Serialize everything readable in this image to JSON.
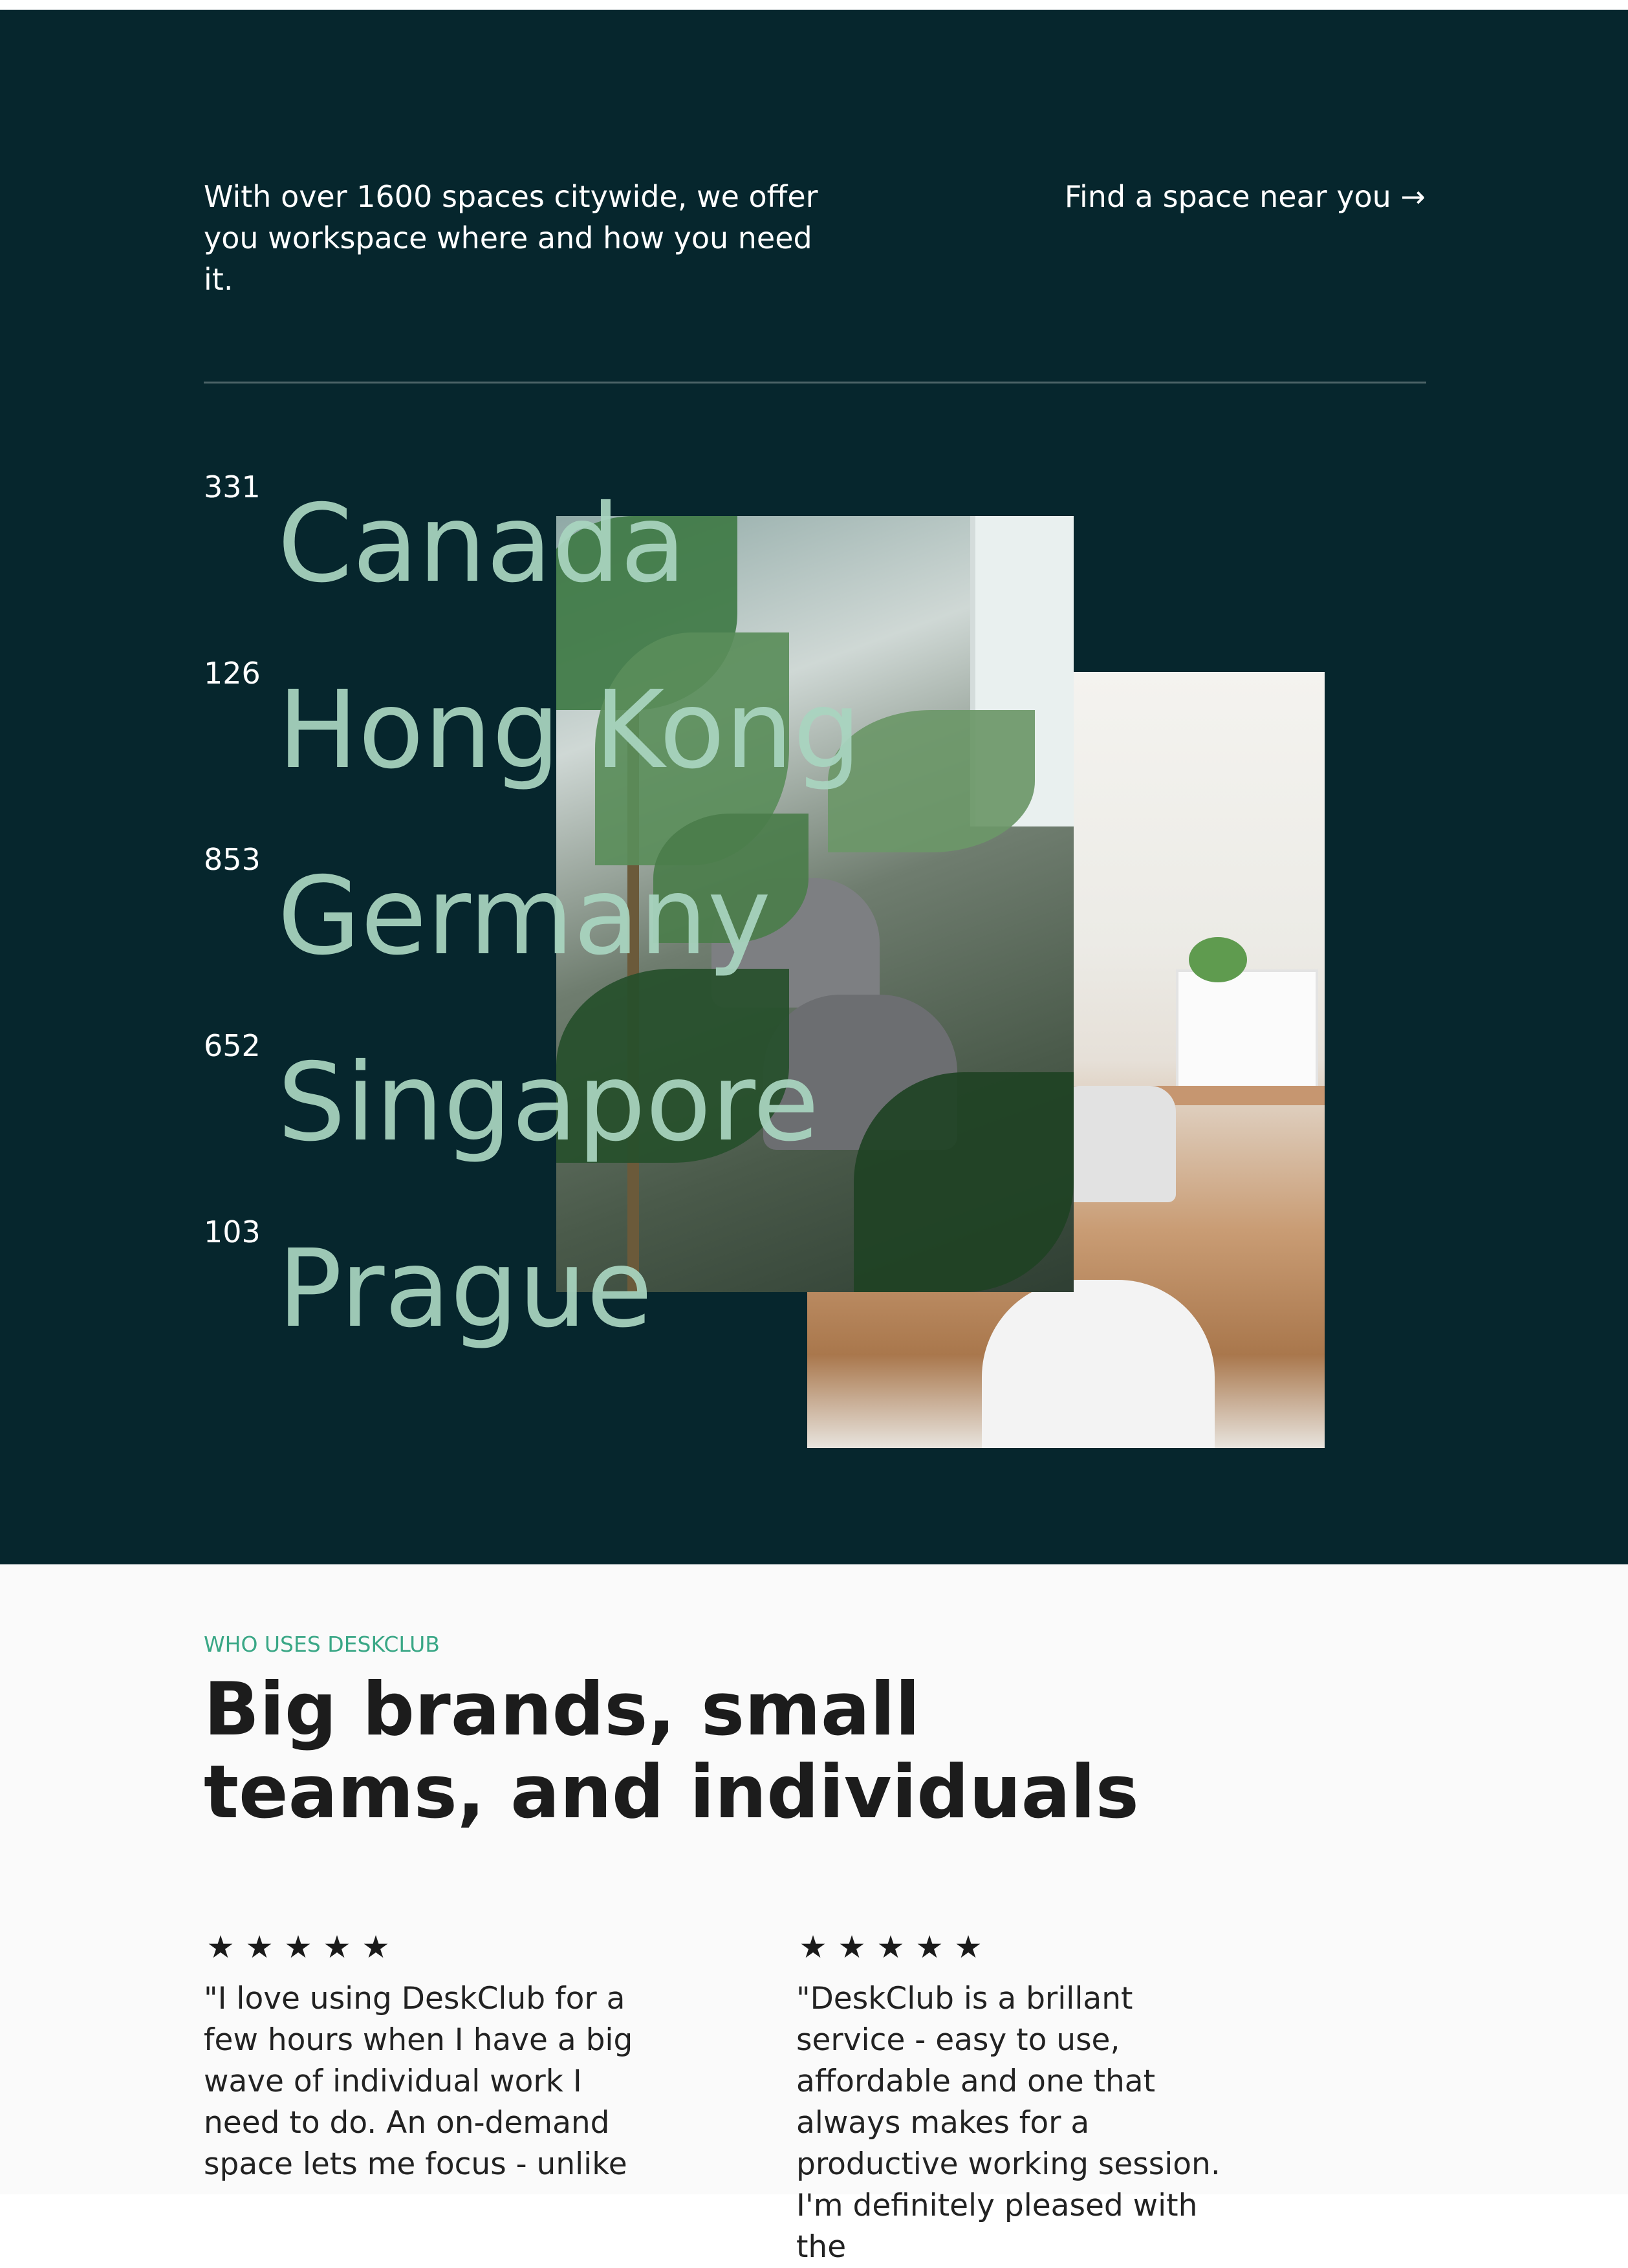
{
  "hero": {
    "intro": "With over 1600 spaces citywide, we offer you workspace where and how you need it.",
    "find_link": "Find a space near you →"
  },
  "locations": [
    {
      "count": "331",
      "name": "Canada"
    },
    {
      "count": "126",
      "name": "Hong Kong"
    },
    {
      "count": "853",
      "name": "Germany"
    },
    {
      "count": "652",
      "name": "Singapore"
    },
    {
      "count": "103",
      "name": "Prague"
    }
  ],
  "users": {
    "eyebrow": "WHO USES DESKCLUB",
    "heading": "Big brands, small teams, and individuals"
  },
  "reviews": [
    {
      "stars": [
        "★",
        "★",
        "★",
        "★",
        "★"
      ],
      "quote": "\"I love using DeskClub for a few hours when I have a big wave of individual work I need to do. An on-demand space lets me focus - unlike"
    },
    {
      "stars": [
        "★",
        "★",
        "★",
        "★",
        "★"
      ],
      "quote": "\"DeskClub is a brillant service - easy to use, affordable and one that always makes for a productive working session. I'm definitely pleased with the"
    }
  ],
  "colors": {
    "dark_bg": "#06262d",
    "location_name": "#a9d5c0",
    "eyebrow": "#3aa786",
    "light_bg": "#fafafa"
  }
}
